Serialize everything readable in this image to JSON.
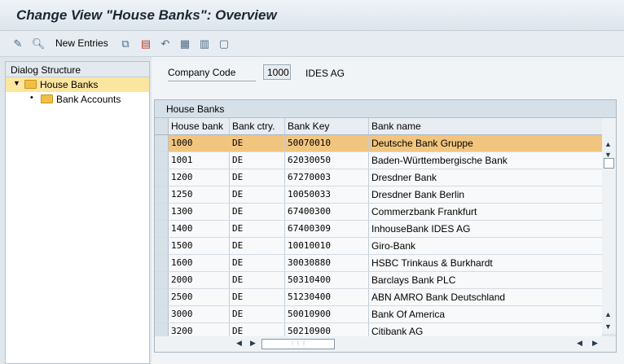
{
  "window": {
    "title": "Change View \"House Banks\": Overview"
  },
  "toolbar": {
    "new_entries_label": "New Entries",
    "icons": [
      "display-change-icon",
      "details-icon",
      "copy-icon",
      "delete-icon",
      "undo-icon",
      "select-all-icon",
      "select-block-icon",
      "deselect-all-icon"
    ]
  },
  "dialog_structure": {
    "header": "Dialog Structure",
    "items": [
      {
        "label": "House Banks",
        "selected": true
      },
      {
        "label": "Bank Accounts",
        "selected": false
      }
    ]
  },
  "company": {
    "label": "Company Code",
    "code": "1000",
    "name": "IDES AG"
  },
  "table": {
    "title": "House Banks",
    "columns": [
      "House bank",
      "Bank ctry.",
      "Bank Key",
      "Bank name"
    ],
    "rows": [
      {
        "house_bank": "1000",
        "country": "DE",
        "bank_key": "50070010",
        "bank_name": "Deutsche Bank Gruppe"
      },
      {
        "house_bank": "1001",
        "country": "DE",
        "bank_key": "62030050",
        "bank_name": "Baden-Württembergische Bank"
      },
      {
        "house_bank": "1200",
        "country": "DE",
        "bank_key": "67270003",
        "bank_name": "Dresdner Bank"
      },
      {
        "house_bank": "1250",
        "country": "DE",
        "bank_key": "10050033",
        "bank_name": "Dresdner Bank Berlin"
      },
      {
        "house_bank": "1300",
        "country": "DE",
        "bank_key": "67400300",
        "bank_name": "Commerzbank Frankfurt"
      },
      {
        "house_bank": "1400",
        "country": "DE",
        "bank_key": "67400309",
        "bank_name": "InhouseBank IDES AG"
      },
      {
        "house_bank": "1500",
        "country": "DE",
        "bank_key": "10010010",
        "bank_name": "Giro-Bank"
      },
      {
        "house_bank": "1600",
        "country": "DE",
        "bank_key": "30030880",
        "bank_name": "HSBC Trinkaus & Burkhardt"
      },
      {
        "house_bank": "2000",
        "country": "DE",
        "bank_key": "50310400",
        "bank_name": "Barclays Bank PLC"
      },
      {
        "house_bank": "2500",
        "country": "DE",
        "bank_key": "51230400",
        "bank_name": "ABN AMRO Bank Deutschland"
      },
      {
        "house_bank": "3000",
        "country": "DE",
        "bank_key": "50010900",
        "bank_name": "Bank Of America"
      },
      {
        "house_bank": "3200",
        "country": "DE",
        "bank_key": "50210900",
        "bank_name": "Citibank AG"
      }
    ],
    "selected_row": 0
  },
  "colors": {
    "selected_row": "#f2c57f",
    "tree_selected": "#fbe6a0",
    "folder": "#f2bf46"
  }
}
